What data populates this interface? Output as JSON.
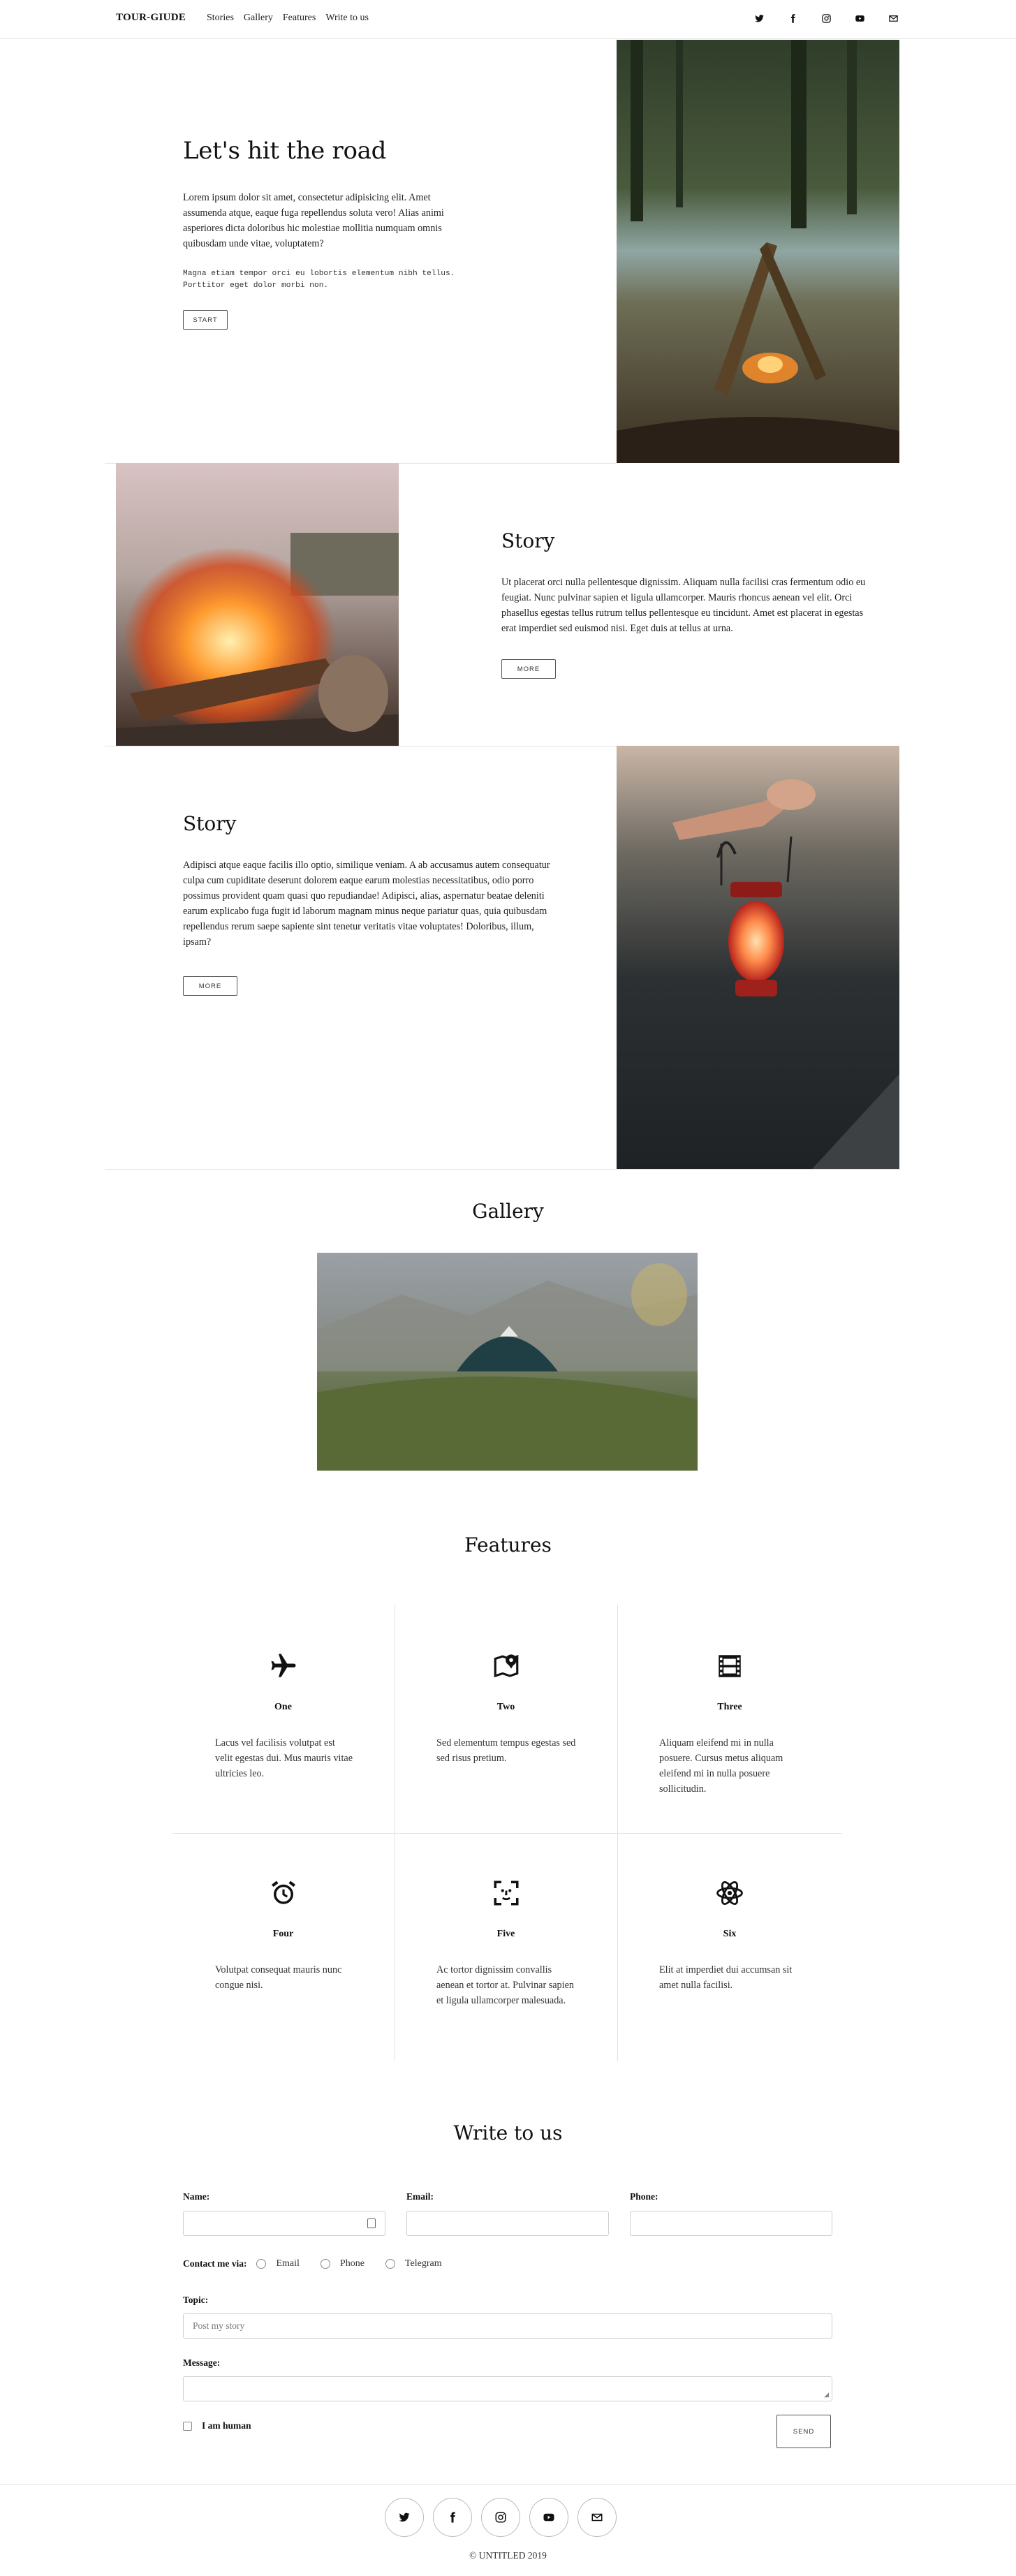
{
  "header": {
    "brand": "TOUR-GIUDE",
    "nav": [
      "Stories",
      "Gallery",
      "Features",
      "Write to us"
    ],
    "social_icons": [
      "twitter-icon",
      "facebook-icon",
      "instagram-icon",
      "youtube-icon",
      "mail-icon"
    ]
  },
  "hero": {
    "title": "Let's hit the road",
    "text": "Lorem ipsum dolor sit amet, consectetur adipisicing elit. Amet assumenda atque, eaque fuga repellendus soluta vero! Alias animi asperiores dicta doloribus hic molestiae mollitia numquam omnis quibusdam unde vitae, voluptatem?",
    "mono_text": "Magna etiam tempor orci eu lobortis elementum nibh tellus. Porttitor eget dolor morbi non.",
    "button": "START",
    "image": "campfire-forest-photo"
  },
  "story1": {
    "title": "Story",
    "text": "Ut placerat orci nulla pellentesque dignissim. Aliquam nulla facilisi cras fermentum odio eu feugiat. Nunc pulvinar sapien et ligula ullamcorper. Mauris rhoncus aenean vel elit. Orci phasellus egestas tellus rutrum tellus pellentesque eu tincidunt. Amet est placerat in egestas erat imperdiet sed euismod nisi. Eget duis at tellus at urna.",
    "button": "MORE",
    "image": "bonfire-photo"
  },
  "story2": {
    "title": "Story",
    "text": "Adipisci atque eaque facilis illo optio, similique veniam. A ab accusamus autem consequatur culpa cum cupiditate deserunt dolorem eaque earum molestias necessitatibus, odio porro possimus provident quam quasi quo repudiandae! Adipisci, alias, aspernatur beatae deleniti earum explicabo fuga fugit id laborum magnam minus neque pariatur quas, quia quibusdam repellendus rerum saepe sapiente sint tenetur veritatis vitae voluptates! Doloribus, illum, ipsam?",
    "button": "MORE",
    "image": "lantern-photo"
  },
  "gallery": {
    "title": "Gallery",
    "image": "tent-mountain-photo"
  },
  "features": {
    "title": "Features",
    "items": [
      {
        "icon": "airplane-icon",
        "title": "One",
        "text": "Lacus vel facilisis volutpat est velit egestas dui. Mus mauris vitae ultricies leo."
      },
      {
        "icon": "map-pin-icon",
        "title": "Two",
        "text": "Sed elementum tempus egestas sed sed risus pretium."
      },
      {
        "icon": "film-icon",
        "title": "Three",
        "text": "Aliquam eleifend mi in nulla posuere. Cursus metus aliquam eleifend mi in nulla posuere sollicitudin."
      },
      {
        "icon": "alarm-clock-icon",
        "title": "Four",
        "text": "Volutpat consequat mauris nunc congue nisi."
      },
      {
        "icon": "face-id-icon",
        "title": "Five",
        "text": "Ac tortor dignissim convallis aenean et tortor at. Pulvinar sapien et ligula ullamcorper malesuada."
      },
      {
        "icon": "atom-icon",
        "title": "Six",
        "text": "Elit at imperdiet dui accumsan sit amet nulla facilisi."
      }
    ]
  },
  "contact": {
    "title": "Write to us",
    "name_label": "Name:",
    "email_label": "Email:",
    "phone_label": "Phone:",
    "contact_via_label": "Contact me via:",
    "options": [
      "Email",
      "Phone",
      "Telegram"
    ],
    "topic_label": "Topic:",
    "topic_placeholder": "Post my story",
    "message_label": "Message:",
    "human_label": "I am human",
    "send": "SEND"
  },
  "footer": {
    "social_icons": [
      "twitter-icon",
      "facebook-icon",
      "instagram-icon",
      "youtube-icon",
      "mail-icon"
    ],
    "copyright": "© UNTITLED 2019"
  }
}
